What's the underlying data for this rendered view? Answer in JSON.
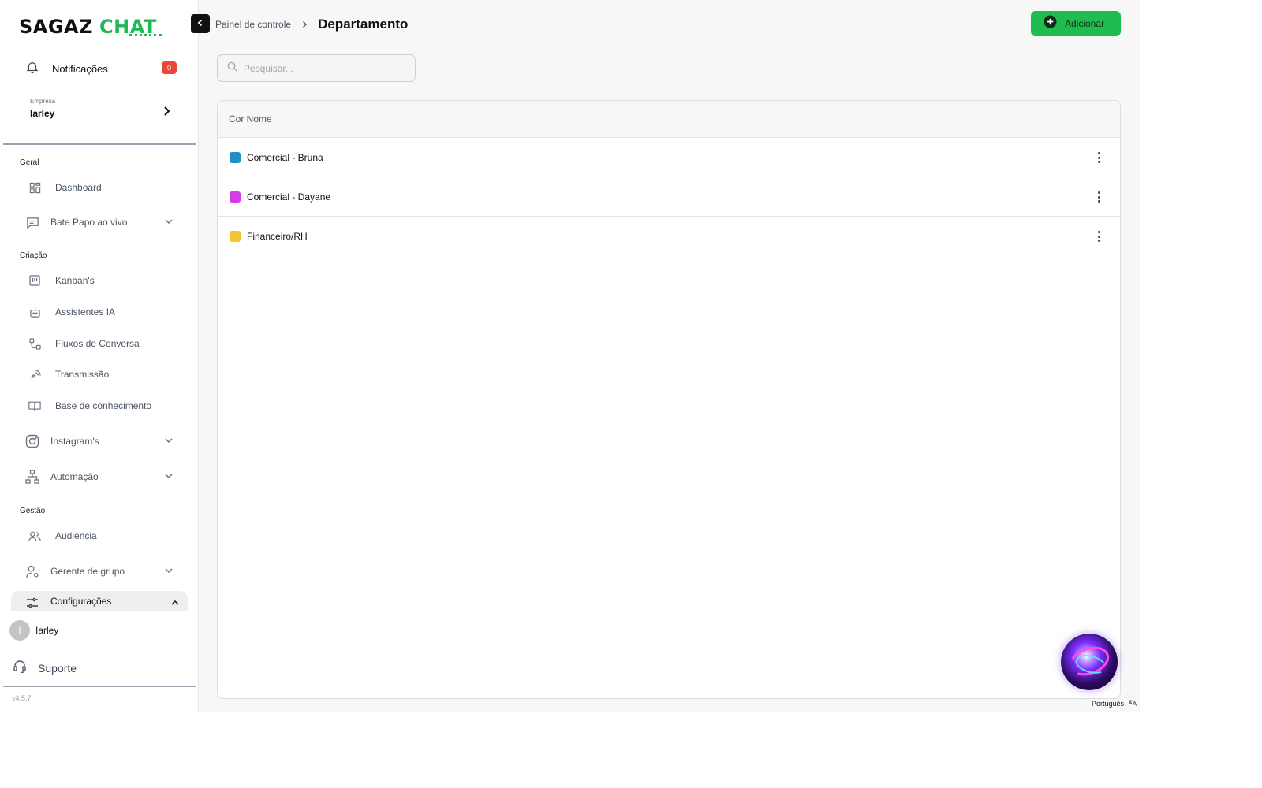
{
  "logo": {
    "part1": "SAGAZ",
    "part2": "CHAT"
  },
  "sidebar": {
    "notifications": {
      "label": "Notificações",
      "count": "0"
    },
    "company": {
      "caption": "Empresa",
      "name": "Iarley"
    },
    "sections": {
      "geral": "Geral",
      "criacao": "Criação",
      "gestao": "Gestão"
    },
    "items": {
      "dashboard": "Dashboard",
      "bate_papo": "Bate Papo ao vivo",
      "kanban": "Kanban's",
      "assistentes": "Assistentes IA",
      "fluxos": "Fluxos de Conversa",
      "transmissao": "Transmissão",
      "base": "Base de conhecimento",
      "instagram": "Instagram's",
      "automacao": "Automação",
      "audiencia": "Audiência",
      "gerente": "Gerente de grupo",
      "configuracoes": "Configurações"
    },
    "user": {
      "initial": "I",
      "name": "Iarley"
    },
    "support": "Suporte",
    "version": "v4.5.7"
  },
  "header": {
    "breadcrumb_parent": "Painel de controle",
    "title": "Departamento",
    "add_label": "Adicionar"
  },
  "search": {
    "placeholder": "Pesquisar..."
  },
  "table": {
    "header": "Cor Nome",
    "rows": [
      {
        "name": "Comercial - Bruna",
        "color": "#1f8fca"
      },
      {
        "name": "Comercial - Dayane",
        "color": "#d63be8"
      },
      {
        "name": "Financeiro/RH",
        "color": "#f5c233"
      }
    ]
  },
  "language": "Português",
  "colors": {
    "accent": "#1fbd4f",
    "badge": "#e5483b"
  }
}
